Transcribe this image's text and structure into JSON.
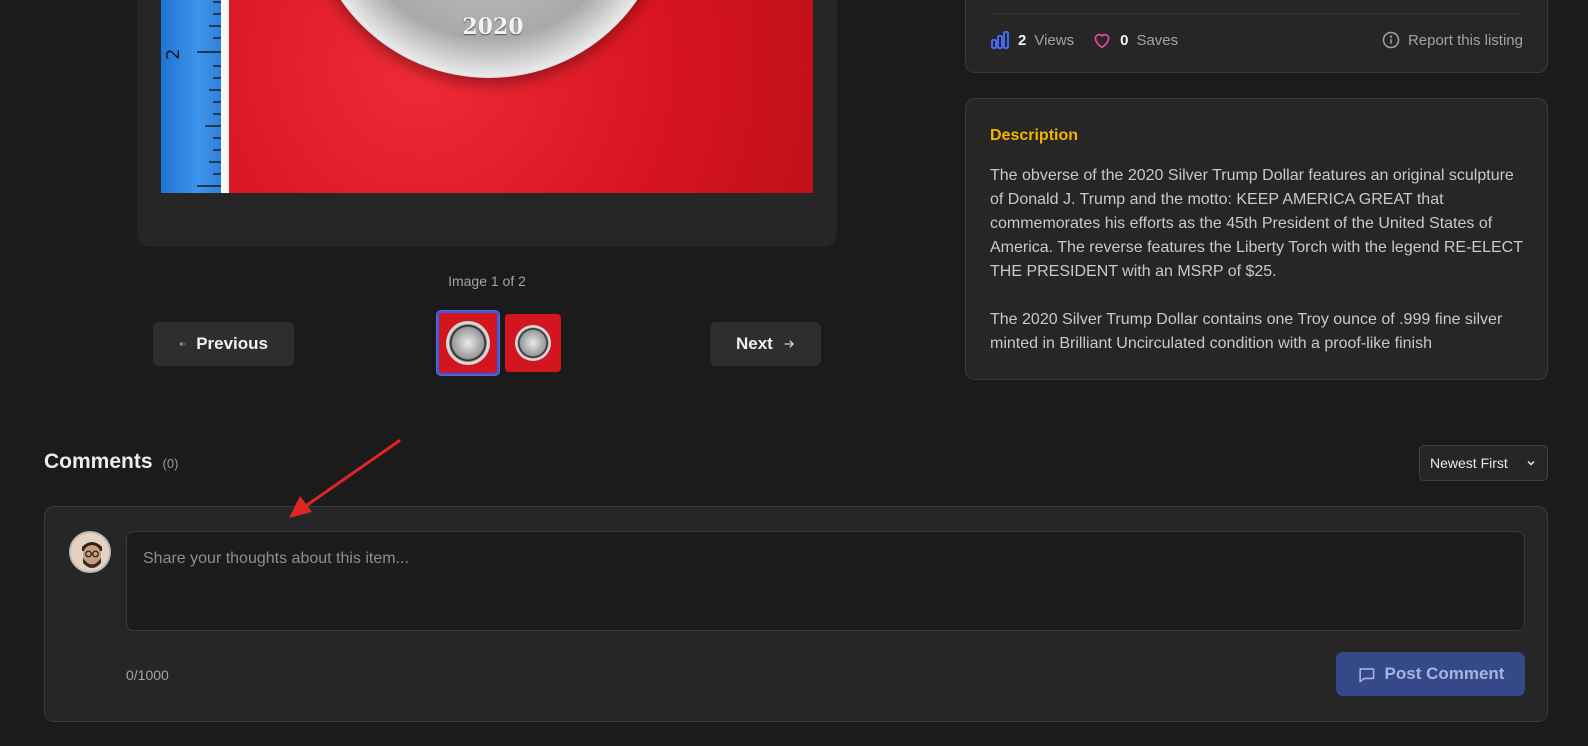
{
  "gallery": {
    "coin_year": "2020",
    "counter": "Image 1 of 2",
    "previous_label": "Previous",
    "next_label": "Next",
    "thumbnails": [
      {
        "active": true
      },
      {
        "active": false
      }
    ]
  },
  "stats": {
    "views_value": "2",
    "views_label": "Views",
    "saves_value": "0",
    "saves_label": "Saves",
    "report_label": "Report this listing"
  },
  "description": {
    "title": "Description",
    "text": "The obverse of the 2020 Silver Trump Dollar features an original sculpture of Donald J. Trump and the motto: KEEP AMERICA GREAT that commemorates his efforts as the 45th President of the United States of America. The reverse features the Liberty Torch with the legend RE-ELECT THE PRESIDENT with an MSRP of $25.\n\nThe 2020 Silver Trump Dollar contains one Troy ounce of .999 fine silver minted in Brilliant Uncirculated condition with a proof-like finish"
  },
  "comments": {
    "title": "Comments",
    "count": "(0)",
    "sort_selected": "Newest First",
    "input_placeholder": "Share your thoughts about this item...",
    "char_count": "0/1000",
    "post_label": "Post Comment"
  },
  "colors": {
    "accent_yellow": "#f5b400",
    "primary_button": "#354887",
    "views_icon": "#4c6fff",
    "saves_icon": "#ec4899",
    "annotation_arrow": "#e02424"
  },
  "icons": {
    "previous": "arrow-left-icon",
    "next": "arrow-right-icon",
    "views": "bar-chart-icon",
    "saves": "heart-icon",
    "report": "info-circle-icon",
    "sort": "chevron-down-icon",
    "post": "chat-bubble-icon"
  }
}
